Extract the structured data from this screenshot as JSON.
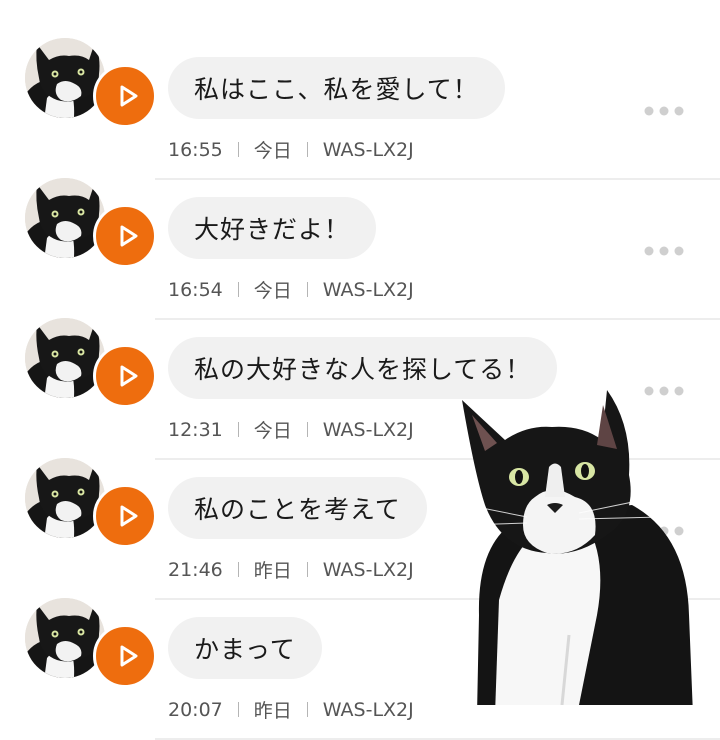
{
  "messages": [
    {
      "text": "私はここ、私を愛して！",
      "time": "16:55",
      "day": "今日",
      "device": "WAS-LX2J"
    },
    {
      "text": "大好きだよ！",
      "time": "16:54",
      "day": "今日",
      "device": "WAS-LX2J"
    },
    {
      "text": "私の大好きな人を探してる！",
      "time": "12:31",
      "day": "今日",
      "device": "WAS-LX2J"
    },
    {
      "text": "私のことを考えて",
      "time": "21:46",
      "day": "昨日",
      "device": "WAS-LX2J"
    },
    {
      "text": "かまって",
      "time": "20:07",
      "day": "昨日",
      "device": "WAS-LX2J"
    }
  ],
  "icons": {
    "play": "play-icon",
    "more": "more-dots-icon",
    "avatar": "cat-avatar"
  },
  "colors": {
    "accent": "#ee6d0e",
    "bubble": "#f1f1f1",
    "meta": "#555555"
  }
}
